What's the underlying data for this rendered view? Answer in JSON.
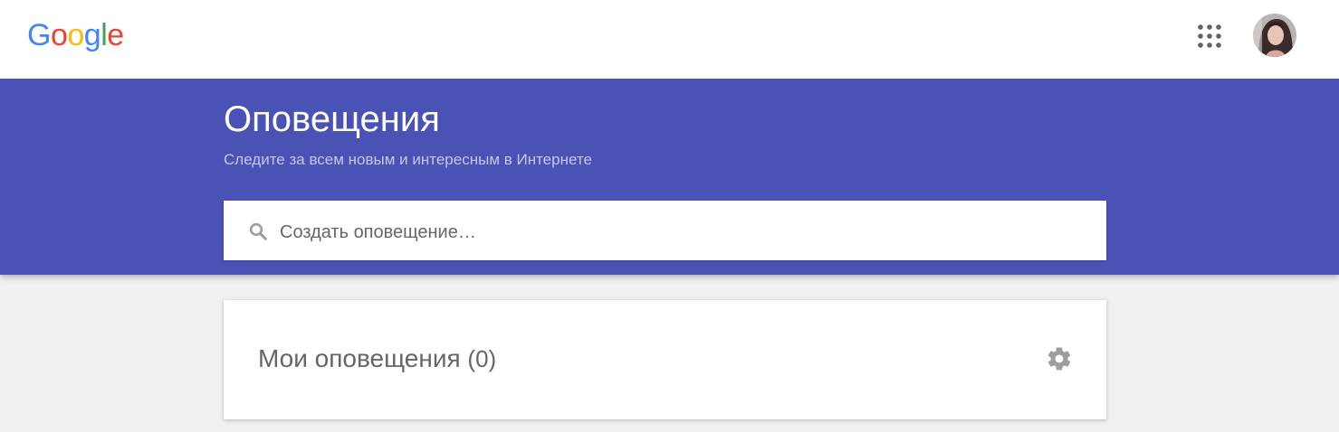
{
  "header": {
    "logo_letters": [
      {
        "ch": "G",
        "color": "#4285F4"
      },
      {
        "ch": "o",
        "color": "#EA4335"
      },
      {
        "ch": "o",
        "color": "#FBBC05"
      },
      {
        "ch": "g",
        "color": "#4285F4"
      },
      {
        "ch": "l",
        "color": "#34A853"
      },
      {
        "ch": "e",
        "color": "#EA4335"
      }
    ],
    "apps_icon": "apps-grid-icon",
    "avatar_icon": "user-avatar"
  },
  "hero": {
    "title": "Оповещения",
    "subtitle": "Следите за всем новым и интересным в Интернете",
    "background": "#4a52b5"
  },
  "search": {
    "placeholder": "Создать оповещение…",
    "value": "",
    "icon": "search-icon"
  },
  "alerts": {
    "title": "Мои оповещения",
    "count": "(0)",
    "settings_icon": "gear-icon"
  }
}
